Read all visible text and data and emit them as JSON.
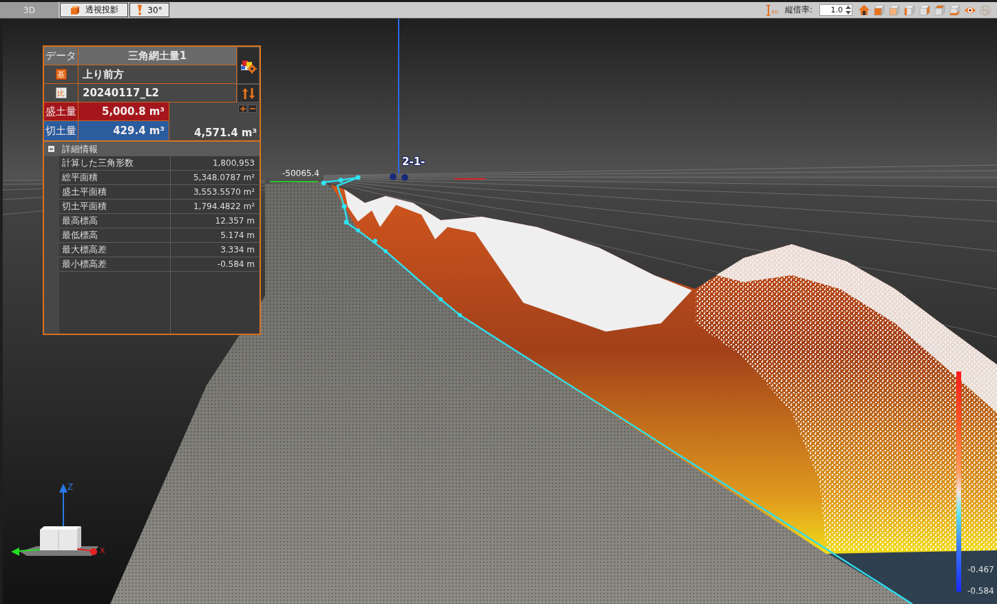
{
  "toolbar": {
    "view_label": "3D",
    "projection_button": "透視投影",
    "angle_button": "30°",
    "scale_icon_label": "xn",
    "scale_label": "縦倍率:",
    "scale_value": "1.0",
    "view_buttons": [
      {
        "kind": "home",
        "disabled": false
      },
      {
        "kind": "front",
        "disabled": false
      },
      {
        "kind": "back",
        "disabled": false
      },
      {
        "kind": "left",
        "disabled": false
      },
      {
        "kind": "right",
        "disabled": false
      },
      {
        "kind": "top",
        "disabled": false
      },
      {
        "kind": "bottom",
        "disabled": false
      },
      {
        "kind": "eye",
        "disabled": false
      },
      {
        "kind": "globe",
        "disabled": true
      }
    ]
  },
  "volume_panel": {
    "data_label": "データ",
    "title": "三角網土量1",
    "base": {
      "tag": "基",
      "name": "上り前方"
    },
    "compare": {
      "tag": "比",
      "name": "20240117_L2"
    },
    "fill": {
      "label": "盛土量",
      "value": "5,000.8 m³"
    },
    "cut": {
      "label": "切土量",
      "value": "429.4 m³"
    },
    "net_value": "4,571.4 m³",
    "details": {
      "title": "詳細情報",
      "expanded": true,
      "rows": [
        {
          "label": "計算した三角形数",
          "value": "1,800,953"
        },
        {
          "label": "総平面積",
          "value": "5,348.0787 m²"
        },
        {
          "label": "盛土平面積",
          "value": "3,553.5570 m²"
        },
        {
          "label": "切土平面積",
          "value": "1,794.4822 m²"
        },
        {
          "label": "最高標高",
          "value": "12.357 m"
        },
        {
          "label": "最低標高",
          "value": "5.174 m"
        },
        {
          "label": "最大標高差",
          "value": "3.334 m"
        },
        {
          "label": "最小標高差",
          "value": "-0.584 m"
        }
      ]
    }
  },
  "scene_labels": [
    "-50065.4",
    "2-1-"
  ],
  "color_scale": {
    "labels": [
      "-0.467",
      "-0.584"
    ]
  },
  "axis_gizmo": {
    "labels": [
      "Z",
      "X"
    ]
  }
}
